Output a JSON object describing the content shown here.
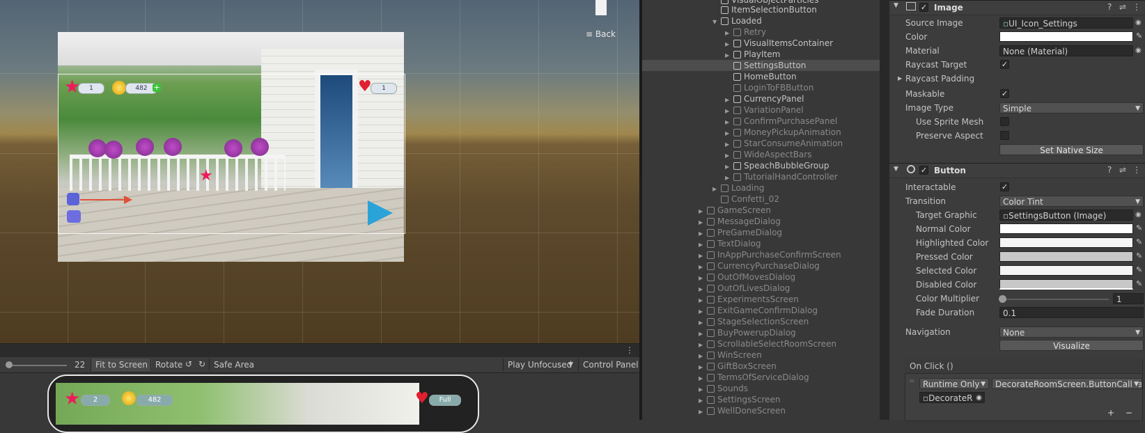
{
  "scene": {
    "back_label": "Back",
    "hud": {
      "stars": "1",
      "coins": "482",
      "lives": "1"
    },
    "game_hud": {
      "stars": "2",
      "coins": "482",
      "lives_label": "Full"
    }
  },
  "scene_toolbar": {
    "scale_value": "22",
    "fit_to_screen": "Fit to Screen",
    "rotate": "Rotate",
    "safe_area": "Safe Area",
    "play_unfocused": "Play Unfocused",
    "control_panel": "Control Panel"
  },
  "hierarchy": {
    "items": [
      {
        "label": "VisualObjectParticles",
        "depth": 1,
        "dim": false,
        "arrow": ""
      },
      {
        "label": "ItemSelectionButton",
        "depth": 1,
        "dim": false,
        "arrow": ""
      },
      {
        "label": "Loaded",
        "depth": 1,
        "dim": false,
        "arrow": "▼"
      },
      {
        "label": "Retry",
        "depth": 2,
        "dim": true,
        "arrow": "▶"
      },
      {
        "label": "VisualItemsContainer",
        "depth": 2,
        "dim": false,
        "arrow": "▶"
      },
      {
        "label": "PlayItem",
        "depth": 2,
        "dim": false,
        "arrow": "▶"
      },
      {
        "label": "SettingsButton",
        "depth": 2,
        "dim": false,
        "arrow": "",
        "selected": true
      },
      {
        "label": "HomeButton",
        "depth": 2,
        "dim": false,
        "arrow": ""
      },
      {
        "label": "LoginToFBButton",
        "depth": 2,
        "dim": true,
        "arrow": ""
      },
      {
        "label": "CurrencyPanel",
        "depth": 2,
        "dim": false,
        "arrow": "▶"
      },
      {
        "label": "VariationPanel",
        "depth": 2,
        "dim": true,
        "arrow": "▶"
      },
      {
        "label": "ConfirmPurchasePanel",
        "depth": 2,
        "dim": true,
        "arrow": "▶"
      },
      {
        "label": "MoneyPickupAnimation",
        "depth": 2,
        "dim": true,
        "arrow": "▶"
      },
      {
        "label": "StarConsumeAnimation",
        "depth": 2,
        "dim": true,
        "arrow": "▶"
      },
      {
        "label": "WideAspectBars",
        "depth": 2,
        "dim": true,
        "arrow": "▶"
      },
      {
        "label": "SpeachBubbleGroup",
        "depth": 2,
        "dim": false,
        "arrow": "▶"
      },
      {
        "label": "TutorialHandController",
        "depth": 2,
        "dim": true,
        "arrow": "▶"
      },
      {
        "label": "Loading",
        "depth": 1,
        "dim": true,
        "arrow": "▶"
      },
      {
        "label": "Confetti_02",
        "depth": 1,
        "dim": true,
        "arrow": ""
      },
      {
        "label": "GameScreen",
        "depth": 0,
        "dim": true,
        "arrow": "▶"
      },
      {
        "label": "MessageDialog",
        "depth": 0,
        "dim": true,
        "arrow": "▶"
      },
      {
        "label": "PreGameDialog",
        "depth": 0,
        "dim": true,
        "arrow": "▶"
      },
      {
        "label": "TextDialog",
        "depth": 0,
        "dim": true,
        "arrow": "▶"
      },
      {
        "label": "InAppPurchaseConfirmScreen",
        "depth": 0,
        "dim": true,
        "arrow": "▶"
      },
      {
        "label": "CurrencyPurchaseDialog",
        "depth": 0,
        "dim": true,
        "arrow": "▶"
      },
      {
        "label": "OutOfMovesDialog",
        "depth": 0,
        "dim": true,
        "arrow": "▶"
      },
      {
        "label": "OutOfLivesDialog",
        "depth": 0,
        "dim": true,
        "arrow": "▶"
      },
      {
        "label": "ExperimentsScreen",
        "depth": 0,
        "dim": true,
        "arrow": "▶"
      },
      {
        "label": "ExitGameConfirmDialog",
        "depth": 0,
        "dim": true,
        "arrow": "▶"
      },
      {
        "label": "StageSelectionScreen",
        "depth": 0,
        "dim": true,
        "arrow": "▶"
      },
      {
        "label": "BuyPowerupDialog",
        "depth": 0,
        "dim": true,
        "arrow": "▶"
      },
      {
        "label": "ScrollableSelectRoomScreen",
        "depth": 0,
        "dim": true,
        "arrow": "▶"
      },
      {
        "label": "WinScreen",
        "depth": 0,
        "dim": true,
        "arrow": "▶"
      },
      {
        "label": "GiftBoxScreen",
        "depth": 0,
        "dim": true,
        "arrow": "▶"
      },
      {
        "label": "TermsOfServiceDialog",
        "depth": 0,
        "dim": true,
        "arrow": "▶"
      },
      {
        "label": "Sounds",
        "depth": 0,
        "dim": true,
        "arrow": "▶"
      },
      {
        "label": "SettingsScreen",
        "depth": 0,
        "dim": true,
        "arrow": "▶"
      },
      {
        "label": "WellDoneScreen",
        "depth": 0,
        "dim": true,
        "arrow": "▶"
      }
    ]
  },
  "inspector": {
    "image": {
      "title": "Image",
      "source_image_label": "Source Image",
      "source_image_value": "UI_Icon_Settings",
      "color_label": "Color",
      "material_label": "Material",
      "material_value": "None (Material)",
      "raycast_target_label": "Raycast Target",
      "raycast_padding_label": "Raycast Padding",
      "maskable_label": "Maskable",
      "image_type_label": "Image Type",
      "image_type_value": "Simple",
      "use_sprite_mesh_label": "Use Sprite Mesh",
      "preserve_aspect_label": "Preserve Aspect",
      "set_native_size": "Set Native Size"
    },
    "button": {
      "title": "Button",
      "interactable_label": "Interactable",
      "transition_label": "Transition",
      "transition_value": "Color Tint",
      "target_graphic_label": "Target Graphic",
      "target_graphic_value": "SettingsButton (Image)",
      "normal_color_label": "Normal Color",
      "highlighted_color_label": "Highlighted Color",
      "pressed_color_label": "Pressed Color",
      "selected_color_label": "Selected Color",
      "disabled_color_label": "Disabled Color",
      "color_multiplier_label": "Color Multiplier",
      "color_multiplier_value": "1",
      "fade_duration_label": "Fade Duration",
      "fade_duration_value": "0.1",
      "navigation_label": "Navigation",
      "navigation_value": "None",
      "visualize": "Visualize",
      "on_click_label": "On Click ()",
      "runtime_value": "Runtime Only",
      "function_value": "DecorateRoomScreen.ButtonCallba",
      "object_value": "DecorateR",
      "add": "+",
      "remove": "−"
    }
  },
  "colors": {
    "selection": "#4d4d4d",
    "accent_link": "#4a90e2"
  }
}
